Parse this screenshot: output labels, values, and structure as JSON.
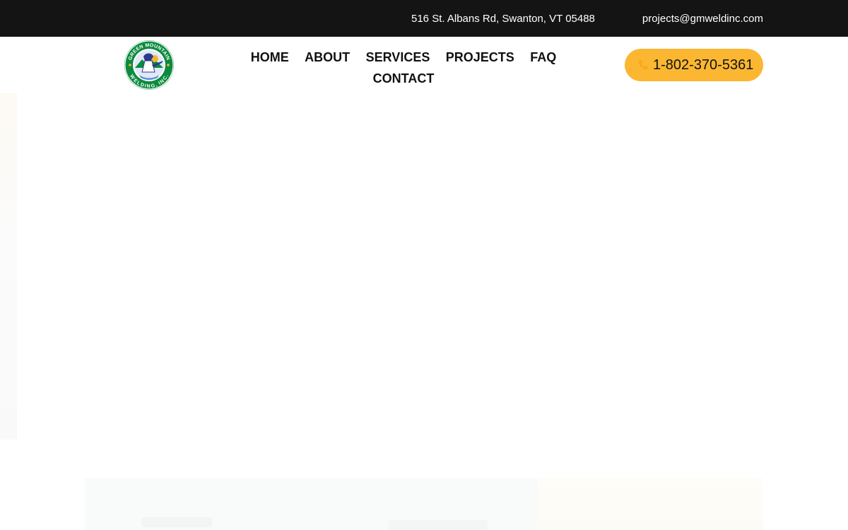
{
  "topbar": {
    "address": "516 St. Albans Rd, Swanton, VT 05488",
    "email": "projects@gmweldinc.com"
  },
  "logo": {
    "top_text": "GREEN MOUNTAIN",
    "bottom_text": "WELDING, INC.",
    "colors": {
      "ring": "#0c8a3e",
      "sky": "#3a6fc4",
      "sun": "#f2b632",
      "welder": "#2a3a8c"
    }
  },
  "nav": {
    "items": [
      {
        "label": "HOME"
      },
      {
        "label": "ABOUT"
      },
      {
        "label": "SERVICES"
      },
      {
        "label": "PROJECTS"
      },
      {
        "label": "FAQ"
      },
      {
        "label": "CONTACT"
      }
    ]
  },
  "cta": {
    "phone": "1-802-370-5361",
    "icon": "phone-icon",
    "color": "#fbb731"
  },
  "colors": {
    "topbar_bg": "#141414",
    "accent": "#fbb731"
  }
}
